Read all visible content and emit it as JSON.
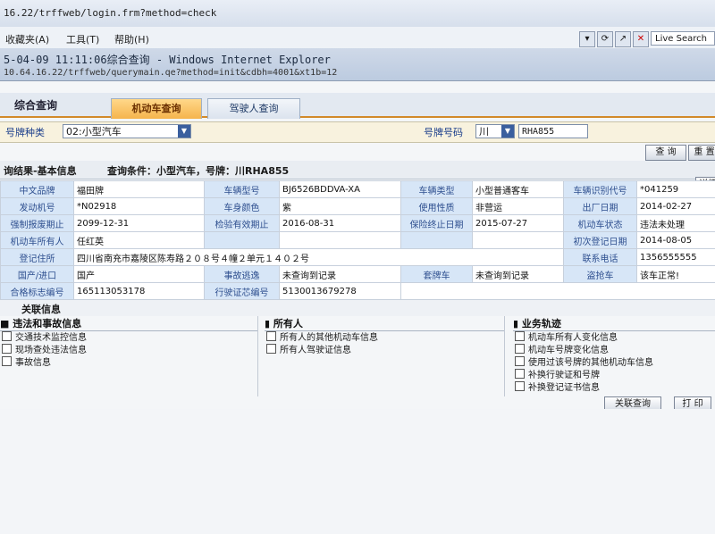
{
  "browser": {
    "address": "16.22/trffweb/login.frm?method=check",
    "menu": [
      "收藏夹(A)",
      "工具(T)",
      "帮助(H)"
    ],
    "window_title": "5-04-09 11:11:06综合查询 - Windows Internet Explorer",
    "url": "10.64.16.22/trffweb/querymain.qe?method=init&cdbh=4001&xt1b=12",
    "live_search": "Live Search",
    "tb_icons": [
      "▾",
      "⟳",
      "↗",
      "✕"
    ]
  },
  "page": {
    "title": "综合查询",
    "tabs": [
      "机动车查询",
      "驾驶人查询"
    ]
  },
  "search": {
    "plate_type_label": "号牌种类",
    "plate_type_value": "02:小型汽车",
    "plate_no_label": "号牌号码",
    "province": "川",
    "plate_no": "RHA855"
  },
  "buttons": {
    "query": "查 询",
    "reset": "重 置",
    "detail": "详细",
    "related_query": "关联查询",
    "print": "打 印"
  },
  "result": {
    "header": "询结果-基本信息",
    "condition": "查询条件：小型汽车，号牌：川RHA855"
  },
  "info": [
    [
      [
        "中文品牌",
        "福田牌"
      ],
      [
        "车辆型号",
        "BJ6526BDDVA-XA"
      ],
      [
        "车辆类型",
        "小型普通客车"
      ],
      [
        "车辆识别代号",
        "*041259"
      ]
    ],
    [
      [
        "发动机号",
        "*N02918"
      ],
      [
        "车身颜色",
        "紫"
      ],
      [
        "使用性质",
        "非营运"
      ],
      [
        "出厂日期",
        "2014-02-27"
      ]
    ],
    [
      [
        "强制报废期止",
        "2099-12-31"
      ],
      [
        "检验有效期止",
        "2016-08-31"
      ],
      [
        "保险终止日期",
        "2015-07-27"
      ],
      [
        "机动车状态",
        "违法未处理"
      ]
    ],
    [
      [
        "机动车所有人",
        "任红英"
      ],
      [
        "",
        ""
      ],
      [
        "",
        ""
      ],
      [
        "初次登记日期",
        "2014-08-05"
      ]
    ],
    [
      [
        "登记住所",
        "四川省南充市嘉陵区陈寿路２０８号４幢２单元１４０２号"
      ],
      [
        "联系电话",
        "1356555555"
      ]
    ],
    [
      [
        "国产/进口",
        "国产"
      ],
      [
        "事故逃逸",
        "未查询到记录"
      ],
      [
        "套牌车",
        "未查询到记录"
      ],
      [
        "盗抢车",
        "该车正常!"
      ]
    ],
    [
      [
        "合格标志编号",
        "165113053178"
      ],
      [
        "行驶证芯编号",
        "5130013679278"
      ]
    ]
  ],
  "related": {
    "header": "关联信息",
    "panels": [
      {
        "title": "违法和事故信息",
        "items": [
          "交通技术监控信息",
          "现场查处违法信息",
          "事故信息"
        ]
      },
      {
        "title": "所有人",
        "items": [
          "所有人的其他机动车信息",
          "所有人驾驶证信息"
        ]
      },
      {
        "title": "业务轨迹",
        "items": [
          "机动车所有人变化信息",
          "机动车号牌变化信息",
          "使用过该号牌的其他机动车信息",
          "补换行驶证和号牌",
          "补换登记证书信息"
        ]
      }
    ]
  },
  "colors": {
    "accent": "#f5b44c",
    "label_bg": "#d7e6f7",
    "alert": "#d80000"
  }
}
